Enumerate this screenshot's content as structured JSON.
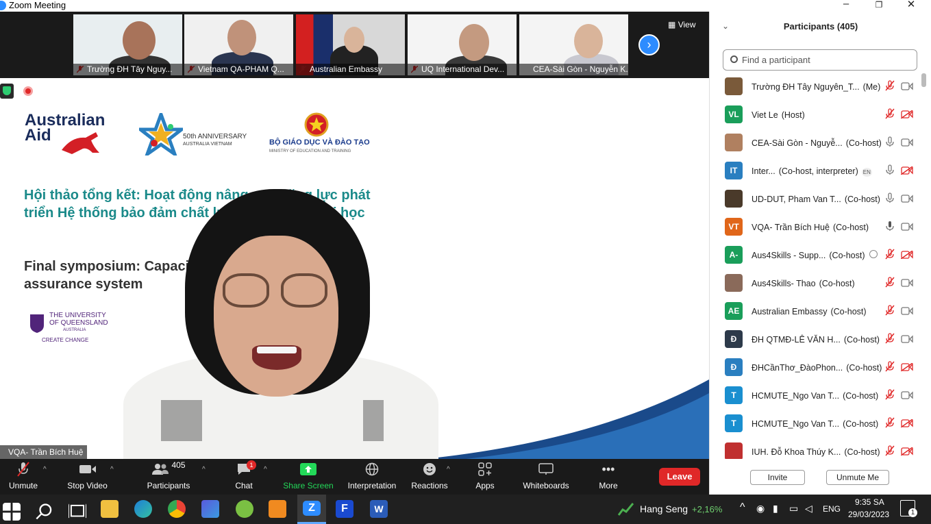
{
  "window": {
    "title": "Zoom Meeting"
  },
  "thumbnails": [
    {
      "label": "Trường ĐH Tây Nguy..."
    },
    {
      "label": "Vietnam QA-PHAM Q..."
    },
    {
      "label": "Australian Embassy"
    },
    {
      "label": "UQ International Dev..."
    },
    {
      "label": "CEA-Sài Gòn - Nguyễn K..."
    }
  ],
  "view_button": "View",
  "slide": {
    "aus_aid_1": "Australian",
    "aus_aid_2": "Aid",
    "anniv_1": "50th ANNIVERSARY",
    "anniv_2": "AUSTRALIA VIETNAM",
    "moet": "BỘ GIÁO DỤC VÀ ĐÀO TẠO",
    "moet_sub": "MINISTRY OF EDUCATION AND TRAINING",
    "title_vn": "Hội thảo tổng kết: Hoạt động nâng cao năng lực phát triển Hệ thống bảo đảm chất lượng giáo dục đại học",
    "title_en": "Final symposium: Capacity building for a quality assurance system",
    "uq_1": "THE UNIVERSITY",
    "uq_2": "OF QUEENSLAND",
    "uq_3": "AUSTRALIA",
    "uq_4": "CREATE CHANGE"
  },
  "speaker_label": "VQA- Trần Bích Huệ",
  "toolbar": {
    "unmute": "Unmute",
    "stop_video": "Stop Video",
    "participants": "Participants",
    "participants_count": "405",
    "chat": "Chat",
    "chat_badge": "1",
    "share_screen": "Share Screen",
    "interpretation": "Interpretation",
    "reactions": "Reactions",
    "apps": "Apps",
    "whiteboards": "Whiteboards",
    "more": "More",
    "leave": "Leave"
  },
  "panel": {
    "title": "Participants (405)",
    "search_placeholder": "Find a participant",
    "invite": "Invite",
    "unmute_me": "Unmute Me",
    "participants": [
      {
        "initials": "",
        "color": "#7a5a3a",
        "name": "Trường ĐH Tây Nguyên_T...",
        "role": "(Me)",
        "mic": "muted",
        "cam": "on"
      },
      {
        "initials": "VL",
        "color": "#1a9e5a",
        "name": "Viet Le",
        "role": "(Host)",
        "mic": "muted",
        "cam": "off"
      },
      {
        "initials": "",
        "color": "#b08060",
        "name": "CEA-Sài Gòn - Nguyễ...",
        "role": "(Co-host)",
        "mic": "on",
        "cam": "on"
      },
      {
        "initials": "IT",
        "color": "#2a7fc0",
        "name": "Inter...",
        "role": "(Co-host, interpreter)",
        "tag": "EN",
        "mic": "on",
        "cam": "off"
      },
      {
        "initials": "",
        "color": "#4a3a2a",
        "name": "UD-DUT, Pham Van T...",
        "role": "(Co-host)",
        "mic": "on",
        "cam": "on"
      },
      {
        "initials": "VT",
        "color": "#e0661a",
        "name": "VQA- Trần Bích Huệ",
        "role": "(Co-host)",
        "mic": "speaking",
        "cam": "on"
      },
      {
        "initials": "A-",
        "color": "#1a9e5a",
        "name": "Aus4Skills - Supp...",
        "role": "(Co-host)",
        "mic": "muted",
        "cam": "off"
      },
      {
        "initials": "",
        "color": "#8a6a5a",
        "name": "Aus4Skills- Thao",
        "role": "(Co-host)",
        "mic": "muted",
        "cam": "on"
      },
      {
        "initials": "AE",
        "color": "#1a9e5a",
        "name": "Australian Embassy",
        "role": "(Co-host)",
        "mic": "muted",
        "cam": "on"
      },
      {
        "initials": "Đ",
        "color": "#2d3a4a",
        "name": "ĐH QTMĐ-LÊ VĂN H...",
        "role": "(Co-host)",
        "mic": "muted",
        "cam": "on"
      },
      {
        "initials": "Đ",
        "color": "#2a7fc0",
        "name": "ĐHCầnThơ_ĐàoPhon...",
        "role": "(Co-host)",
        "mic": "muted",
        "cam": "off"
      },
      {
        "initials": "T",
        "color": "#1a8fd0",
        "name": "HCMUTE_Ngo Van T...",
        "role": "(Co-host)",
        "mic": "muted",
        "cam": "on"
      },
      {
        "initials": "T",
        "color": "#1a8fd0",
        "name": "HCMUTE_Ngo Van T...",
        "role": "(Co-host)",
        "mic": "muted",
        "cam": "off"
      },
      {
        "initials": "",
        "color": "#c03030",
        "name": "IUH. Đỗ Khoa Thúy K...",
        "role": "(Co-host)",
        "mic": "muted",
        "cam": "off"
      }
    ]
  },
  "taskbar": {
    "stock_name": "Hang Seng",
    "stock_change": "+2,16%",
    "lang": "ENG",
    "time": "9:35 SA",
    "date": "29/03/2023",
    "notif": "1"
  }
}
